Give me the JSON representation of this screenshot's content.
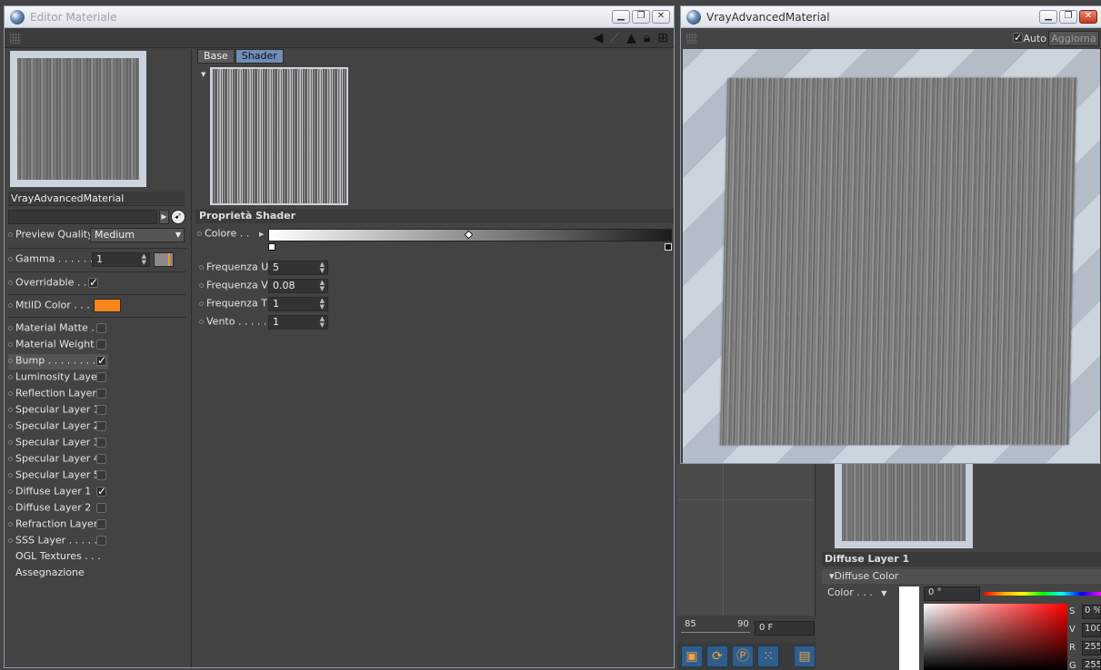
{
  "editor": {
    "title": "Editor Materiale",
    "material_name": "VrayAdvancedMaterial",
    "preview_quality": {
      "label": "Preview Quality",
      "value": "Medium"
    },
    "gamma": {
      "label": "Gamma . . . . . . .",
      "value": "1"
    },
    "overridable": {
      "label": "Overridable . . .",
      "checked": true
    },
    "mtlid_color": {
      "label": "MtlID Color . . . .",
      "color": "#f7851c"
    },
    "channels": [
      {
        "label": "Material Matte . .",
        "checked": false
      },
      {
        "label": "Material Weight",
        "checked": false
      },
      {
        "label": "Bump . . . . . . . . .",
        "checked": true
      },
      {
        "label": "Luminosity Layer",
        "checked": false
      },
      {
        "label": "Reflection Layer",
        "checked": false
      },
      {
        "label": "Specular Layer 1",
        "checked": false
      },
      {
        "label": "Specular Layer 2",
        "checked": false
      },
      {
        "label": "Specular Layer 3",
        "checked": false
      },
      {
        "label": "Specular Layer 4",
        "checked": false
      },
      {
        "label": "Specular Layer 5",
        "checked": false
      },
      {
        "label": "Diffuse Layer 1",
        "checked": true
      },
      {
        "label": "Diffuse Layer 2",
        "checked": false
      },
      {
        "label": "Refraction Layer",
        "checked": false
      },
      {
        "label": "SSS Layer . . . . . .",
        "checked": false
      }
    ],
    "extra_links": [
      "OGL Textures . . .",
      "Assegnazione"
    ],
    "tabs": [
      {
        "label": "Base",
        "active": false
      },
      {
        "label": "Shader",
        "active": true
      }
    ],
    "shader_section_title": "Proprietà Shader",
    "colore_label": "Colore . .",
    "shader_props": [
      {
        "label": "Frequenza U",
        "value": "5"
      },
      {
        "label": "Frequenza V",
        "value": "0.08"
      },
      {
        "label": "Frequenza T",
        "value": "1"
      },
      {
        "label": "Vento . . . . .",
        "value": "1"
      }
    ]
  },
  "vray": {
    "title": "VrayAdvancedMaterial",
    "auto_label": "Auto",
    "auto_checked": true,
    "refresh_label": "Aggiorna"
  },
  "background": {
    "timeline_start": "85",
    "timeline_end": "90",
    "frame_field": "0 F",
    "diffuse_layer_title": "Diffuse Layer 1",
    "diffuse_color_label": "Diffuse Color",
    "color_label": "Color . . .",
    "hue_value": "0 °",
    "s_label": "S",
    "s_value": "0 %",
    "v_label": "V",
    "v_value": "100",
    "r_label": "R",
    "r_value": "255",
    "g_label": "G",
    "g_value": "255"
  },
  "colors": {
    "accent_blue": "#6f8fb8",
    "mtlid_orange": "#f7851c"
  }
}
